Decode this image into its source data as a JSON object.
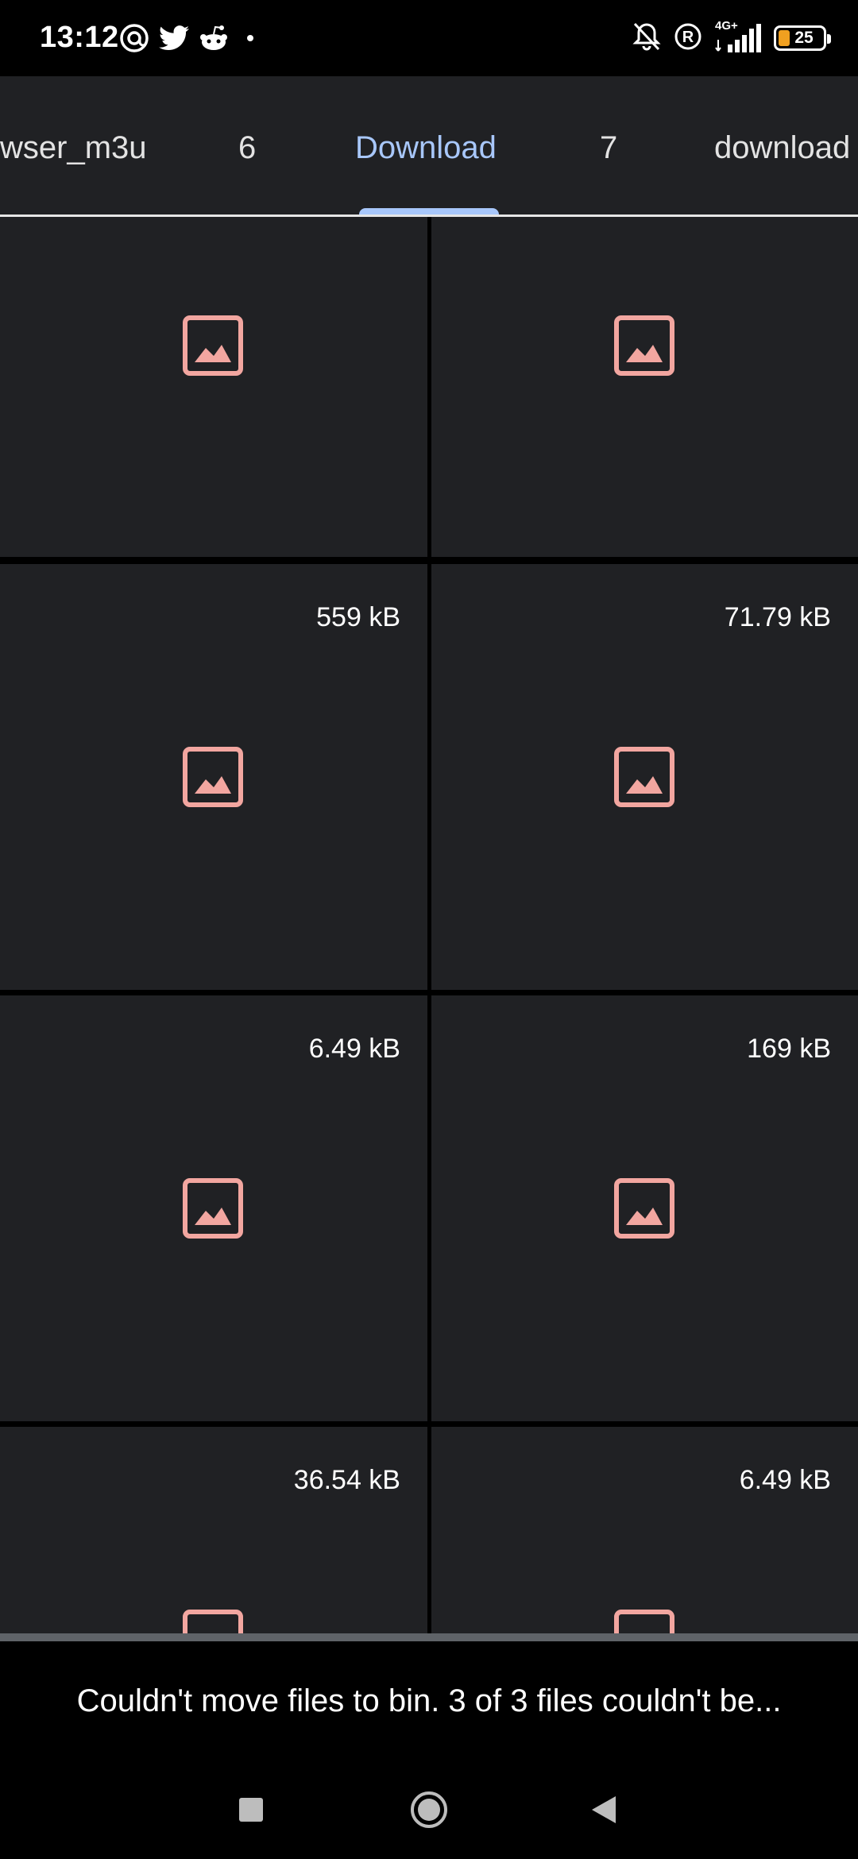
{
  "status_bar": {
    "time": "13:12",
    "left_icons": [
      "threads-icon",
      "twitter-icon",
      "reddit-icon",
      "dot-icon"
    ],
    "right_icons": [
      "bell-off-icon",
      "registered-icon",
      "signal-icon",
      "battery-icon"
    ],
    "network_label": "4G+",
    "battery_percent": "25",
    "battery_level": 0.25
  },
  "tabs": [
    {
      "label": "wser_m3u",
      "active": false
    },
    {
      "label": "6",
      "active": false
    },
    {
      "label": "Download",
      "active": true
    },
    {
      "label": "7",
      "active": false
    },
    {
      "label": "download",
      "active": false
    }
  ],
  "grid": {
    "icon_color": "#f2a6a0",
    "tiles": [
      {
        "size": ""
      },
      {
        "size": ""
      },
      {
        "size": "559 kB"
      },
      {
        "size": "71.79 kB"
      },
      {
        "size": "6.49 kB"
      },
      {
        "size": "169 kB"
      },
      {
        "size": "36.54 kB"
      },
      {
        "size": "6.49 kB"
      }
    ]
  },
  "snackbar": {
    "message": "Couldn't move files to bin. 3 of 3 files couldn't be..."
  },
  "nav_bar": {
    "buttons": [
      "recents-button",
      "home-button",
      "back-button"
    ]
  },
  "colors": {
    "accent": "#a8c7fa",
    "tile_bg": "#202124",
    "icon": "#f2a6a0"
  }
}
